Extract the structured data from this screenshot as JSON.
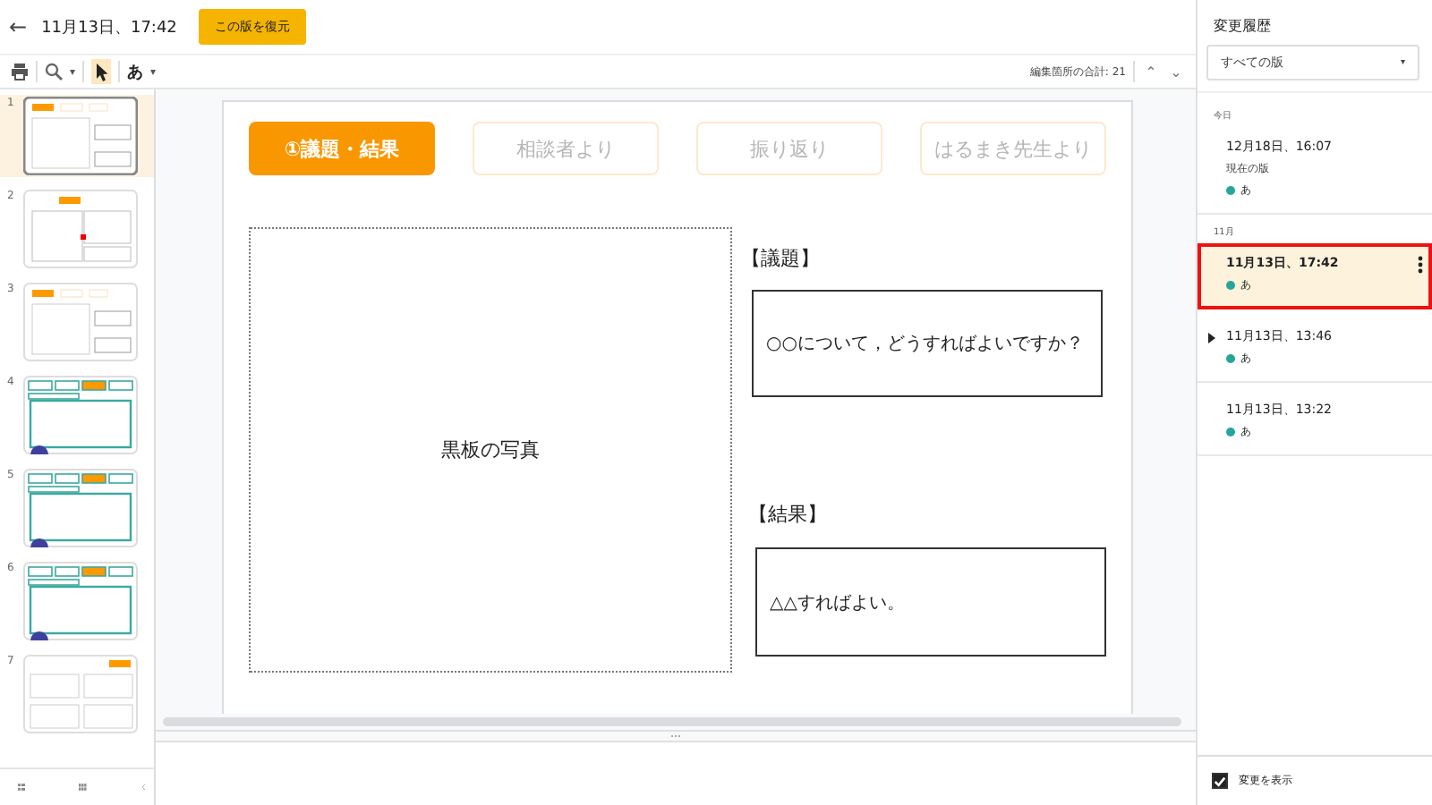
{
  "header": {
    "back": "←",
    "title": "11月13日、17:42",
    "restore_button": "この版を復元"
  },
  "toolbar": {
    "zoom_caret": "▾",
    "input_label": "あ",
    "input_caret": "▾",
    "edit_count": "編集箇所の合計: 21",
    "prev": "⌃",
    "next": "⌄",
    "pointer_selected": true
  },
  "thumbnails": [
    {
      "number": "1",
      "selected": true,
      "kind": "plain"
    },
    {
      "number": "2",
      "selected": false,
      "kind": "split"
    },
    {
      "number": "3",
      "selected": false,
      "kind": "plain"
    },
    {
      "number": "4",
      "selected": false,
      "kind": "teal"
    },
    {
      "number": "5",
      "selected": false,
      "kind": "teal"
    },
    {
      "number": "6",
      "selected": false,
      "kind": "teal"
    },
    {
      "number": "7",
      "selected": false,
      "kind": "grid"
    }
  ],
  "slide": {
    "tabs": [
      {
        "label": "①議題・結果",
        "selected": true
      },
      {
        "label": "相談者より",
        "selected": false
      },
      {
        "label": "振り返り",
        "selected": false
      },
      {
        "label": "はるまき先生より",
        "selected": false
      }
    ],
    "photo_label": "黒板の写真",
    "topic_heading": "【議題】",
    "topic_text": "○○について，どうすればよいですか？",
    "result_heading": "【結果】",
    "result_text": "△△すればよい。"
  },
  "history": {
    "title": "変更履歴",
    "filter": "すべての版",
    "filter_caret": "▾",
    "groups": [
      {
        "label": "今日",
        "items": [
          {
            "time": "12月18日、16:07",
            "note": "現在の版",
            "author": "あ",
            "color": "#26a69a",
            "selected": false,
            "kind": "version"
          }
        ]
      },
      {
        "label": "11月",
        "items": [
          {
            "time": "11月13日、17:42",
            "author": "あ",
            "color": "#26a69a",
            "selected": true,
            "kind": "version"
          },
          {
            "time": "11月13日、13:46",
            "author": "あ",
            "color": "#26a69a",
            "selected": false,
            "kind": "collapsed"
          },
          {
            "time": "11月13日、13:22",
            "author": "あ",
            "color": "#26a69a",
            "selected": false,
            "kind": "version"
          }
        ]
      }
    ],
    "show_changes": {
      "label": "変更を表示",
      "checked": true
    }
  }
}
